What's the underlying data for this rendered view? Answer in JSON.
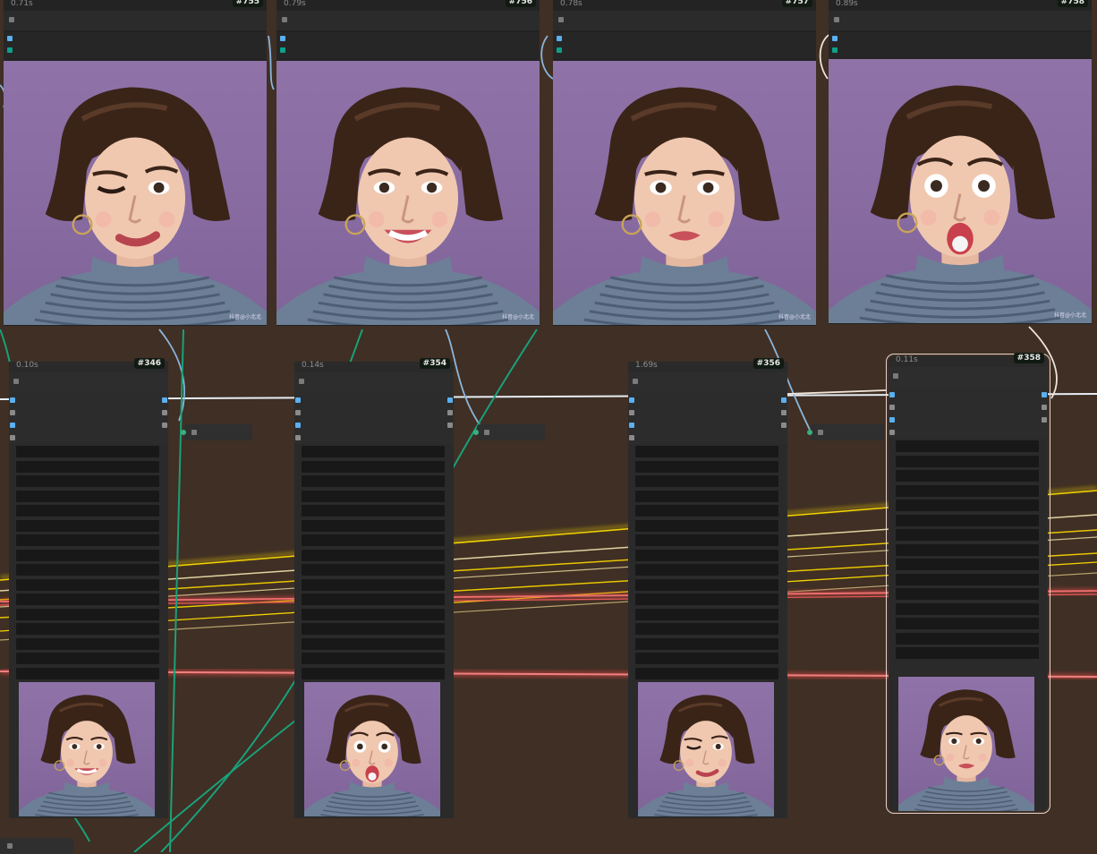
{
  "canvas": {
    "background": "#3f2f24",
    "wire_colors": {
      "image": "#5aa0d8",
      "latent": "#16a085",
      "conditioning": "#e8c600",
      "mask": "#e06060",
      "white": "#f0e4d8"
    }
  },
  "top_nodes": [
    {
      "time": "0.71s",
      "id": "#755",
      "expression": "wink",
      "watermark": "抖音@小北北"
    },
    {
      "time": "0.79s",
      "id": "#756",
      "expression": "smile",
      "watermark": "抖音@小北北"
    },
    {
      "time": "0.78s",
      "id": "#757",
      "expression": "neutral",
      "watermark": "抖音@小北北"
    },
    {
      "time": "0.89s",
      "id": "#758",
      "expression": "surprised",
      "watermark": "抖音@小北北"
    }
  ],
  "editor_nodes": [
    {
      "time": "0.10s",
      "id": "#346",
      "preview": "smile",
      "selected": false
    },
    {
      "time": "0.14s",
      "id": "#354",
      "preview": "surprised",
      "selected": false
    },
    {
      "time": "1.69s",
      "id": "#356",
      "preview": "wink",
      "selected": false
    },
    {
      "time": "0.11s",
      "id": "#358",
      "preview": "neutral",
      "selected": true
    }
  ],
  "icons": {
    "collapse": "collapse-square-icon",
    "port": "slot-port-icon",
    "reroute": "reroute-dot-icon"
  }
}
